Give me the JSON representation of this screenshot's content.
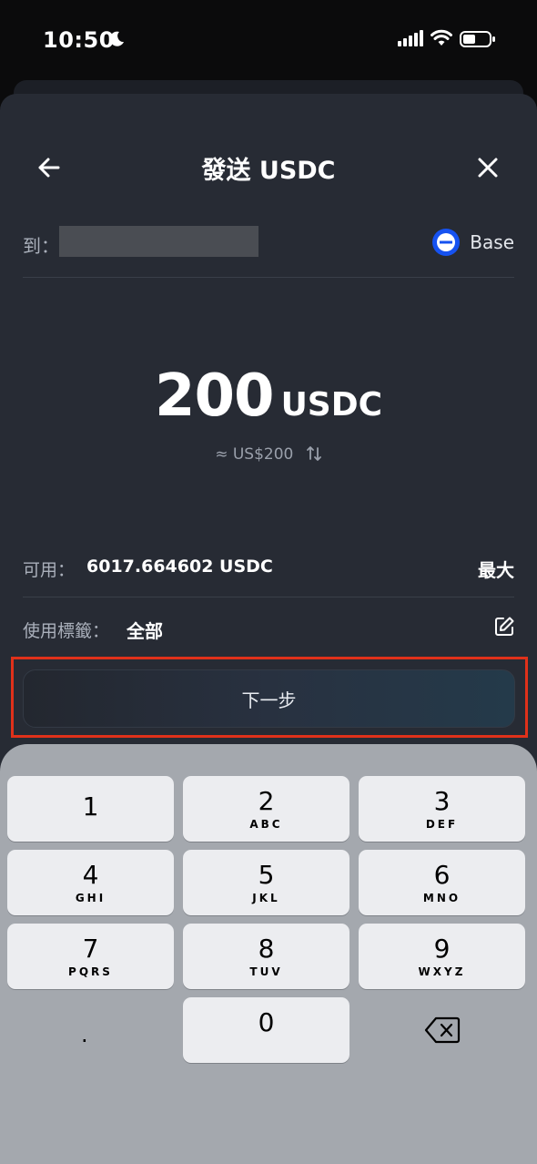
{
  "status_bar": {
    "time": "10:50"
  },
  "header": {
    "title": "發送 USDC"
  },
  "recipient": {
    "label": "到：",
    "network": "Base"
  },
  "amount": {
    "value": "200",
    "unit": "USDC",
    "fiat": "≈ US$200"
  },
  "available": {
    "label": "可用：",
    "value": "6017.664602 USDC",
    "max_label": "最大"
  },
  "tag": {
    "label": "使用標籤：",
    "value": "全部"
  },
  "next_button": {
    "label": "下一步"
  },
  "keypad": {
    "keys": [
      {
        "digit": "1",
        "letters": ""
      },
      {
        "digit": "2",
        "letters": "ABC"
      },
      {
        "digit": "3",
        "letters": "DEF"
      },
      {
        "digit": "4",
        "letters": "GHI"
      },
      {
        "digit": "5",
        "letters": "JKL"
      },
      {
        "digit": "6",
        "letters": "MNO"
      },
      {
        "digit": "7",
        "letters": "PQRS"
      },
      {
        "digit": "8",
        "letters": "TUV"
      },
      {
        "digit": "9",
        "letters": "WXYZ"
      },
      {
        "digit": "0",
        "letters": ""
      }
    ],
    "decimal": "."
  },
  "icons": {
    "moon": "moon-icon",
    "signal": "cellular-signal-icon",
    "wifi": "wifi-icon",
    "battery": "battery-icon",
    "back": "back-arrow-icon",
    "close": "close-icon",
    "network": "base-network-icon",
    "swap": "swap-arrows-icon",
    "edit": "edit-icon",
    "delete": "backspace-icon"
  },
  "colors": {
    "sheet": "#272b34",
    "highlight": "#e0311a",
    "base_blue": "#1652f0",
    "keypad": "#a4a8ae"
  }
}
